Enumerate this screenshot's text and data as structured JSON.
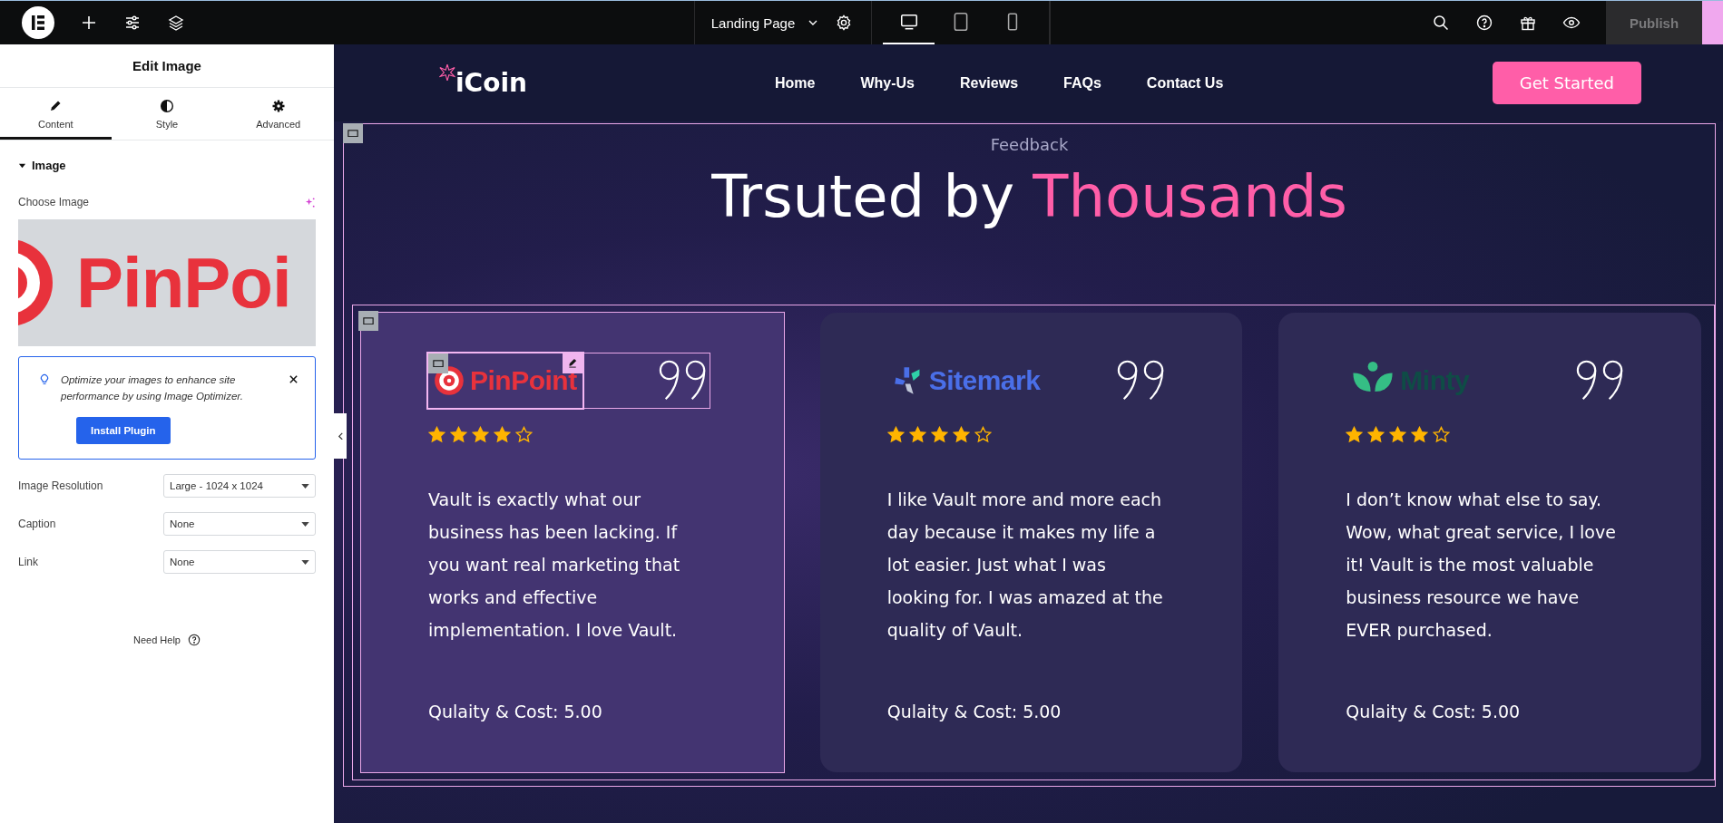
{
  "topbar": {
    "page_name": "Landing Page",
    "devices": [
      {
        "kind": "desktop",
        "selected": true
      },
      {
        "kind": "tablet",
        "selected": false
      },
      {
        "kind": "mobile",
        "selected": false
      }
    ],
    "publish": "Publish"
  },
  "panel": {
    "title": "Edit Image",
    "tabs": [
      {
        "kind": "content",
        "label": "Content",
        "selected": true
      },
      {
        "kind": "style",
        "label": "Style",
        "selected": false
      },
      {
        "kind": "advanced",
        "label": "Advanced",
        "selected": false
      }
    ],
    "section": {
      "title": "Image",
      "expanded": true
    },
    "choose_label": "Choose Image",
    "preview_text": "PinPoi",
    "notice": {
      "text": "Optimize your images to enhance site performance by using Image Optimizer.",
      "button": "Install Plugin"
    },
    "fields": [
      {
        "label": "Image Resolution",
        "value": "Large - 1024 x 1024"
      },
      {
        "label": "Caption",
        "value": "None"
      },
      {
        "label": "Link",
        "value": "None"
      }
    ],
    "help": "Need Help"
  },
  "site": {
    "logo": "iCoin",
    "nav": [
      "Home",
      "Why-Us",
      "Reviews",
      "FAQs",
      "Contact Us"
    ],
    "cta": "Get Started",
    "eyebrow": "Feedback",
    "title": "Trsuted by",
    "title_highlight": "Thousands",
    "cards": [
      {
        "kind": "pinpoint",
        "brand": "PinPoint",
        "selected": true,
        "stars": 4,
        "quote": "Vault is exactly what our business has been lacking. If you want real marketing that works and effective implementation. I love Vault.",
        "score": "Qulaity & Cost: 5.00"
      },
      {
        "kind": "sitemark",
        "brand": "Sitemark",
        "selected": false,
        "stars": 4,
        "quote": "I like Vault more and more each day because it makes my life a lot easier. Just what I was looking for. I was amazed at the quality of Vault.",
        "score": "Qulaity & Cost: 5.00"
      },
      {
        "kind": "minty",
        "brand": "Minty",
        "selected": false,
        "stars": 4,
        "quote": "I don’t know what else to say. Wow, what great service, I love it! Vault is the most valuable business resource we have EVER purchased.",
        "score": "Qulaity & Cost: 5.00"
      }
    ]
  }
}
